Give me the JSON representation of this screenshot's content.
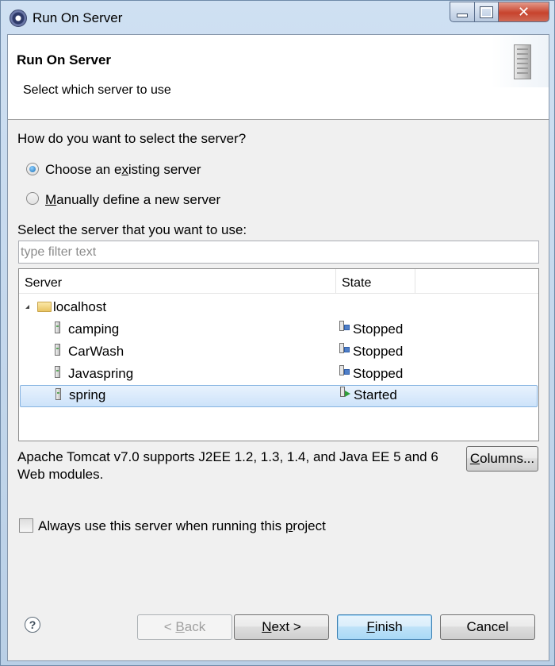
{
  "window": {
    "title": "Run On Server",
    "buttons": {
      "close_glyph": "✕"
    }
  },
  "banner": {
    "title": "Run On Server",
    "description": "Select which server to use"
  },
  "question": "How do you want to select the server?",
  "radios": [
    {
      "pre": "Choose an e",
      "mn": "x",
      "post": "isting server",
      "selected": true
    },
    {
      "pre": "",
      "mn": "M",
      "post": "anually define a new server",
      "selected": false
    }
  ],
  "select_label": "Select the server that you want to use:",
  "filter": {
    "placeholder": "type filter text",
    "value": ""
  },
  "table": {
    "columns": [
      "Server",
      "State"
    ],
    "host": "localhost",
    "rows": [
      {
        "name": "camping",
        "state": "Stopped",
        "selected": false
      },
      {
        "name": "CarWash",
        "state": "Stopped",
        "selected": false
      },
      {
        "name": "Javaspring",
        "state": "Stopped",
        "selected": false
      },
      {
        "name": "spring",
        "state": "Started",
        "selected": true
      }
    ]
  },
  "description": "Apache Tomcat v7.0 supports J2EE 1.2, 1.3, 1.4, and Java EE 5 and 6 Web modules.",
  "columns_button": {
    "mn": "C",
    "rest": "olumns..."
  },
  "always_use": {
    "pre": "Always use this server when running this ",
    "mn": "p",
    "post": "roject",
    "checked": false
  },
  "help_glyph": "?",
  "buttons": {
    "back": {
      "pre": "< ",
      "mn": "B",
      "post": "ack"
    },
    "next": {
      "pre": "",
      "mn": "N",
      "post": "ext >"
    },
    "finish": {
      "pre": "",
      "mn": "F",
      "post": "inish"
    },
    "cancel": "Cancel"
  }
}
